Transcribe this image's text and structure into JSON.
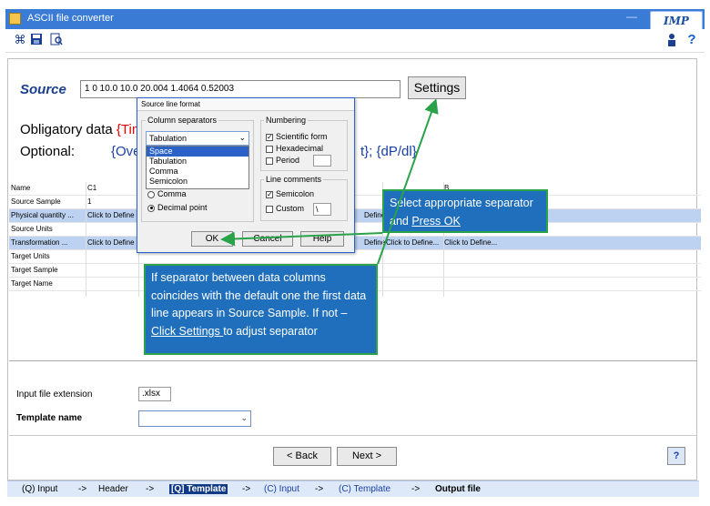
{
  "window": {
    "title": "ASCII file converter",
    "title_right": "—"
  },
  "logo": {
    "text": "IMP"
  },
  "toolbar": {
    "icons": [
      "select-icon",
      "save-icon",
      "preview-icon",
      "user-icon",
      "help-icon"
    ],
    "help_glyph": "?"
  },
  "source": {
    "label": "Source",
    "line": "1 0 10.0 10.0 20.004 1.4064 0.52003",
    "settings_label": "Settings"
  },
  "obligatory": {
    "label": "Obligatory data ",
    "value": "{Tim"
  },
  "optional": {
    "label": "Optional:",
    "part1": "{Ove",
    "part2": "t}; {dP/dl}"
  },
  "grid": {
    "header": {
      "name": "Name",
      "c1": "C1",
      "right": "B"
    },
    "rows": [
      {
        "name": "Source Sample",
        "c1": "1",
        "mid": "",
        "right": "",
        "right2": "",
        "selected": false
      },
      {
        "name": "Physical quantity ...",
        "c1": "Click to Define",
        "mid": "Define",
        "right": "",
        "right2": "",
        "selected": true
      },
      {
        "name": "Source Units",
        "c1": "",
        "mid": "",
        "right": "",
        "right2": "",
        "selected": false
      },
      {
        "name": "Transformation ...",
        "c1": "Click to Define",
        "mid": "Define",
        "right": "Click to Define...",
        "right2": "Click to Define...",
        "selected": true
      },
      {
        "name": "Target Units",
        "c1": "",
        "mid": "",
        "right": "",
        "right2": "",
        "selected": false
      },
      {
        "name": "Target Sample",
        "c1": "",
        "mid": "",
        "right": "",
        "right2": "",
        "selected": false
      },
      {
        "name": "Target Name",
        "c1": "",
        "mid": "",
        "right": "",
        "right2": "",
        "selected": false
      }
    ]
  },
  "dialog": {
    "title": "Source line format",
    "column_separators_label": "Column separators",
    "selected_separator": "Tabulation",
    "dropdown_options": [
      "Space",
      "Tabulation",
      "Comma",
      "Semicolon"
    ],
    "radio_comma": "Comma",
    "radio_decimal": "Decimal point",
    "numbering_label": "Numbering",
    "numbering_options": [
      "Scientific form",
      "Hexadecimal",
      "Period"
    ],
    "line_comments_label": "Line comments",
    "semicolon_label": "Semicolon",
    "custom_label": "Custom",
    "custom_value": "\\",
    "ok_label": "OK",
    "cancel_label": "Cancel",
    "help_label": "Help"
  },
  "callouts": {
    "one_text": "Select appropriate separator and ",
    "one_link": "Press OK",
    "two_text": "If separator between data columns coincides with the default one the first data line appears in Source Sample. If not – ",
    "two_link": "Click Settings ",
    "two_tail": "to adjust separator"
  },
  "form": {
    "input_ext_label": "Input file extension",
    "input_ext_value": ".xlsx",
    "template_label": "Template name",
    "template_value": ""
  },
  "nav": {
    "back_label": "< Back",
    "next_label": "Next >",
    "help_glyph": "?"
  },
  "steps": {
    "items": [
      "(Q) Input",
      "->",
      "Header",
      "->",
      "[Q] Template",
      "->",
      "(C) Input",
      "->",
      "(C) Template",
      "->",
      "Output file"
    ]
  },
  "colors": {
    "titlebar": "#3a7bd5",
    "callout": "#1f6fbd",
    "callout_border": "#2aa24a",
    "arrow": "#2aa24a",
    "selected_row": "#bcd2f0"
  }
}
